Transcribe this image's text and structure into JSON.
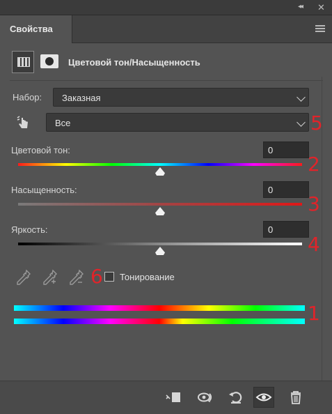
{
  "panel": {
    "tab_label": "Свойства",
    "collapse_glyph": "◂◂",
    "close_glyph": "✕"
  },
  "adjustment": {
    "title": "Цветовой тон/Насыщенность",
    "icons": [
      "hue-saturation-adjustment-icon",
      "layer-mask-icon"
    ]
  },
  "preset": {
    "label": "Набор:",
    "value": "Заказная"
  },
  "range": {
    "value": "Все"
  },
  "sliders": [
    {
      "id": "hue",
      "label": "Цветовой тон:",
      "value": "0",
      "level": 0.5
    },
    {
      "id": "saturation",
      "label": "Насыщенность:",
      "value": "0",
      "level": 0.5
    },
    {
      "id": "lightness",
      "label": "Яркость:",
      "value": "0",
      "level": 0.5
    }
  ],
  "colorize": {
    "label": "Тонирование",
    "checked": false
  },
  "annotations": [
    "1",
    "2",
    "3",
    "4",
    "5",
    "6"
  ],
  "colors": {
    "annotation_red": "#e0242a",
    "panel_bg": "#535353"
  },
  "toolbar": {
    "icons": [
      "clip-to-layer-icon",
      "view-previous-state-icon",
      "reset-icon",
      "visibility-eye-icon",
      "trash-icon"
    ]
  }
}
